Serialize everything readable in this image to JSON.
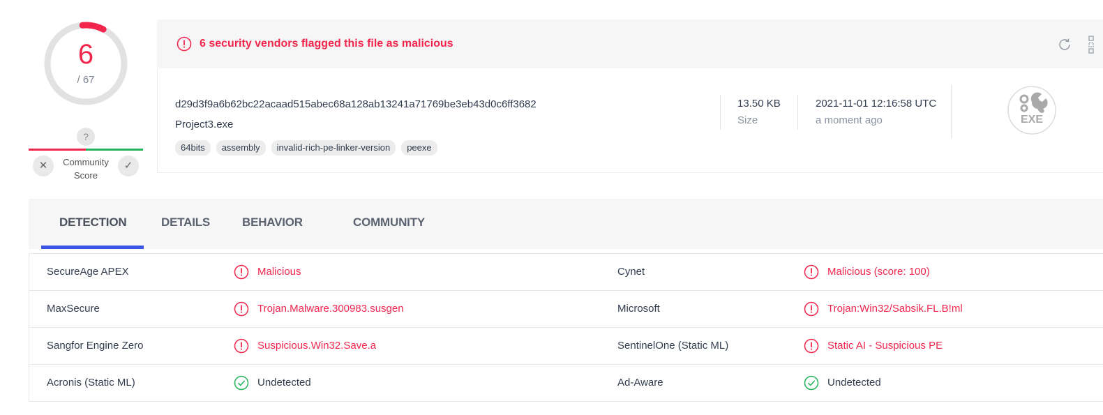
{
  "score": {
    "detections": "6",
    "total": "/ 67",
    "color": "#f2264d",
    "fraction": 0.0896
  },
  "community": {
    "question": "?",
    "label_line1": "Community",
    "label_line2": "Score",
    "downvote": "✕",
    "upvote": "✓"
  },
  "banner": {
    "text": "6 security vendors flagged this file as malicious",
    "icon": "alert-circle-icon"
  },
  "file": {
    "hash": "d29d3f9a6b62bc22acaad515abec68a128ab13241a71769be3eb43d0c6ff3682",
    "name": "Project3.exe",
    "tags": [
      "64bits",
      "assembly",
      "invalid-rich-pe-linker-version",
      "peexe"
    ],
    "size_value": "13.50 KB",
    "size_label": "Size",
    "date_value": "2021-11-01 12:16:58 UTC",
    "date_label": "a moment ago",
    "type_badge": "EXE"
  },
  "tabs": [
    "DETECTION",
    "DETAILS",
    "BEHAVIOR",
    "COMMUNITY"
  ],
  "detections": [
    {
      "left_vendor": "SecureAge APEX",
      "left_result": "Malicious",
      "left_status": "malicious",
      "right_vendor": "Cynet",
      "right_result": "Malicious (score: 100)",
      "right_status": "malicious"
    },
    {
      "left_vendor": "MaxSecure",
      "left_result": "Trojan.Malware.300983.susgen",
      "left_status": "malicious",
      "right_vendor": "Microsoft",
      "right_result": "Trojan:Win32/Sabsik.FL.B!ml",
      "right_status": "malicious"
    },
    {
      "left_vendor": "Sangfor Engine Zero",
      "left_result": "Suspicious.Win32.Save.a",
      "left_status": "malicious",
      "right_vendor": "SentinelOne (Static ML)",
      "right_result": "Static AI - Suspicious PE",
      "right_status": "malicious"
    },
    {
      "left_vendor": "Acronis (Static ML)",
      "left_result": "Undetected",
      "left_status": "clean",
      "right_vendor": "Ad-Aware",
      "right_result": "Undetected",
      "right_status": "clean"
    }
  ],
  "colors": {
    "malicious": "#f2264d",
    "clean": "#24b35a",
    "accent": "#3b54e8"
  }
}
